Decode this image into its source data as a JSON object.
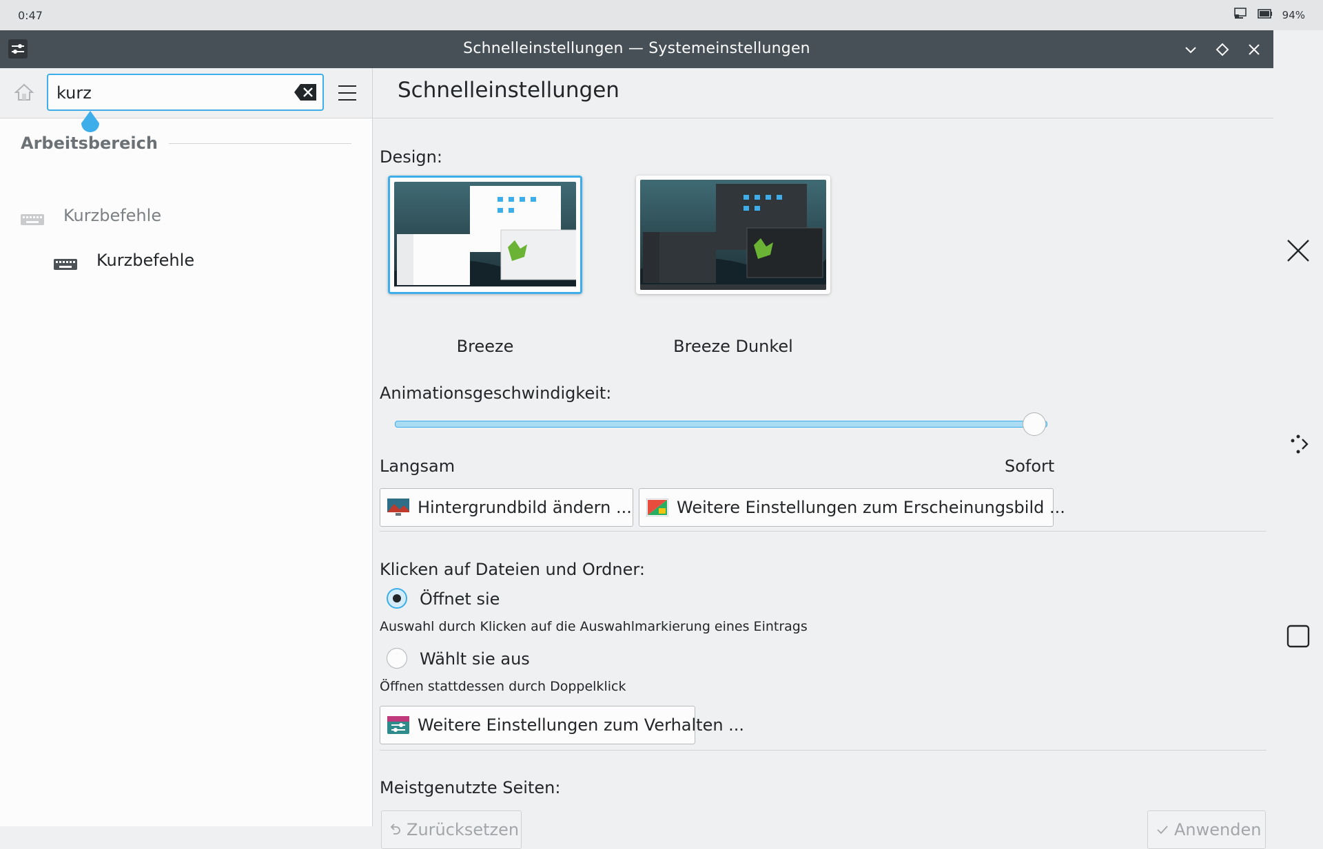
{
  "status_bar": {
    "time": "0:47",
    "battery": "94%"
  },
  "window": {
    "title": "Schnelleinstellungen — Systemeinstellungen"
  },
  "sidebar": {
    "search_value": "kurz",
    "section": "Arbeitsbereich",
    "items": [
      {
        "label": "Kurzbefehle"
      },
      {
        "label": "Kurzbefehle"
      }
    ]
  },
  "main": {
    "page_title": "Schnelleinstellungen",
    "design_label": "Design:",
    "themes": [
      {
        "name": "Breeze"
      },
      {
        "name": "Breeze Dunkel"
      }
    ],
    "animation_label": "Animationsgeschwindigkeit:",
    "animation_value": 1.0,
    "slow_label": "Langsam",
    "fast_label": "Sofort",
    "wallpaper_button": "Hintergrundbild ändern ...",
    "appearance_button": "Weitere Einstellungen zum Erscheinungsbild ...",
    "click_label": "Klicken auf Dateien und Ordner:",
    "option_open": "Öffnet sie",
    "option_open_desc": "Auswahl durch Klicken auf die Auswahlmarkierung eines Eintrags",
    "option_select": "Wählt sie aus",
    "option_select_desc": "Öffnen stattdessen durch Doppelklick",
    "behavior_button": "Weitere Einstellungen zum Verhalten ...",
    "most_used_label": "Meistgenutzte Seiten:",
    "reset_button": "Zurücksetzen",
    "apply_button": "Anwenden"
  },
  "colors": {
    "accent": "#3daee9",
    "titlebar": "#475057",
    "background": "#eff0f1"
  }
}
